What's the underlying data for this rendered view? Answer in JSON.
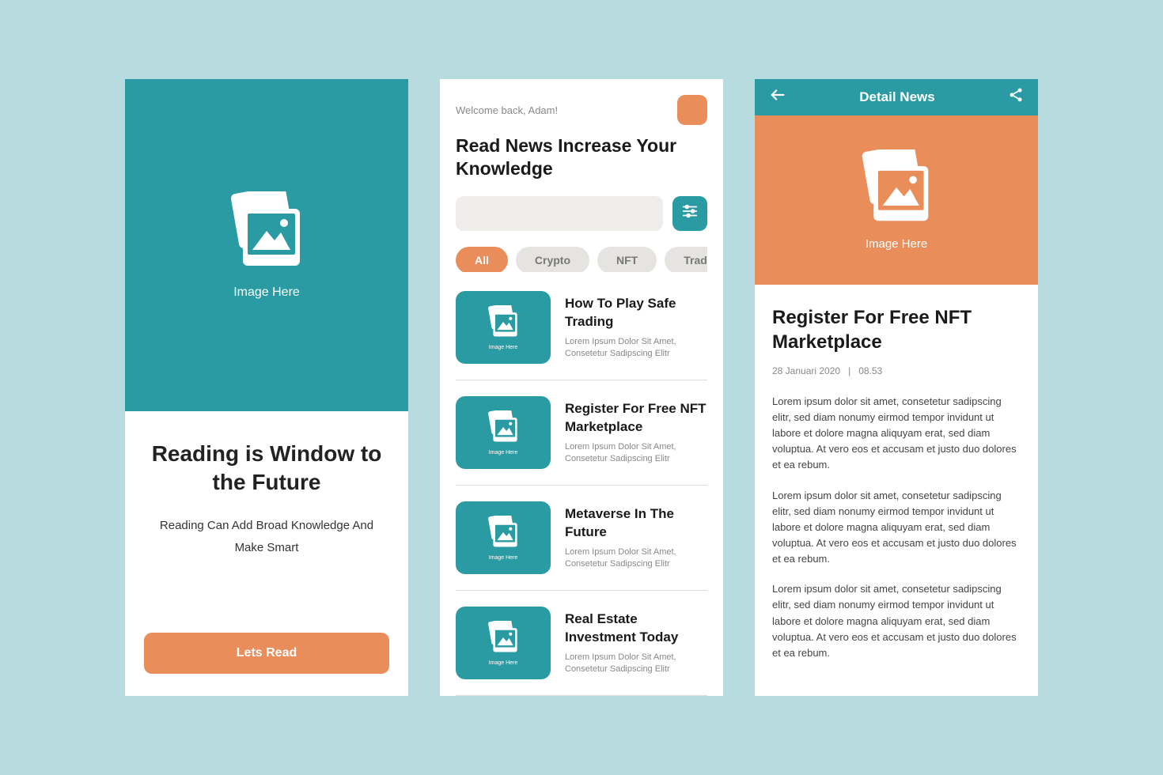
{
  "colors": {
    "teal": "#2a9ba3",
    "orange": "#e98d5b",
    "bg": "#b8dbe0"
  },
  "screen1": {
    "image_caption": "Image Here",
    "title": "Reading is Window to the Future",
    "subtitle": "Reading Can Add Broad Knowledge And Make Smart",
    "cta": "Lets Read"
  },
  "screen2": {
    "welcome": "Welcome back, Adam!",
    "headline": "Read News Increase Your Knowledge",
    "search_placeholder": "",
    "thumb_caption": "Image Here",
    "chips": [
      {
        "label": "All",
        "active": true
      },
      {
        "label": "Crypto",
        "active": false
      },
      {
        "label": "NFT",
        "active": false
      },
      {
        "label": "Trading",
        "active": false
      }
    ],
    "news": [
      {
        "title": "How To Play Safe Trading",
        "desc": "Lorem Ipsum Dolor Sit Amet, Consetetur Sadipscing Elitr"
      },
      {
        "title": "Register For Free NFT Marketplace",
        "desc": "Lorem Ipsum Dolor Sit Amet, Consetetur Sadipscing Elitr"
      },
      {
        "title": "Metaverse In The Future",
        "desc": "Lorem Ipsum Dolor Sit Amet, Consetetur Sadipscing Elitr"
      },
      {
        "title": "Real Estate Investment Today",
        "desc": "Lorem Ipsum Dolor Sit Amet, Consetetur Sadipscing Elitr"
      }
    ]
  },
  "screen3": {
    "appbar_title": "Detail News",
    "hero_caption": "Image Here",
    "title": "Register For Free NFT Marketplace",
    "date": "28  Januari 2020",
    "time": "08.53",
    "paras": [
      "Lorem ipsum dolor sit amet, consetetur sadipscing elitr, sed diam nonumy eirmod tempor invidunt ut labore et dolore magna aliquyam erat, sed diam voluptua. At vero eos et accusam et justo duo dolores et ea rebum.",
      "Lorem ipsum dolor sit amet, consetetur sadipscing elitr, sed diam nonumy eirmod tempor invidunt ut labore et dolore magna aliquyam erat, sed diam voluptua. At vero eos et accusam et justo duo dolores et ea rebum.",
      "Lorem ipsum dolor sit amet, consetetur sadipscing elitr, sed diam nonumy eirmod tempor invidunt ut labore et dolore magna aliquyam erat, sed diam voluptua. At vero eos et accusam et justo duo dolores et ea rebum."
    ]
  }
}
